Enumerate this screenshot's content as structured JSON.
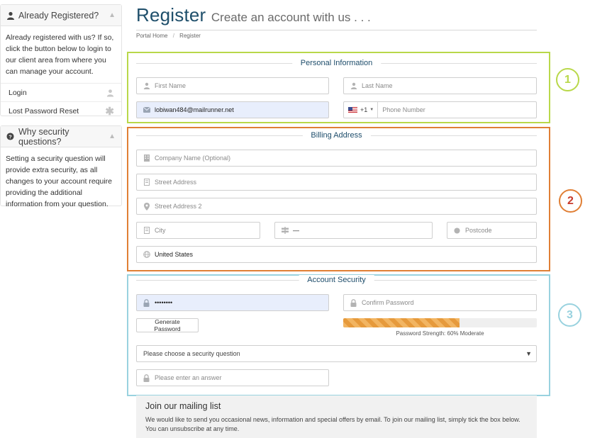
{
  "sidebar": {
    "registered_panel": {
      "title": "Already Registered?",
      "body": "Already registered with us? If so, click the button below to login to our client area from where you can manage your account.",
      "links": [
        {
          "label": "Login",
          "icon": "user-icon"
        },
        {
          "label": "Lost Password Reset",
          "icon": "asterisk-icon"
        }
      ]
    },
    "security_panel": {
      "title": "Why security questions?",
      "body": "Setting a security question will provide extra security, as all changes to your account require providing the additional information from your question."
    }
  },
  "header": {
    "title": "Register",
    "subtitle": "Create an account with us . . .",
    "breadcrumb": [
      "Portal Home",
      "Register"
    ]
  },
  "personal": {
    "legend": "Personal Information",
    "first_name_placeholder": "First Name",
    "last_name_placeholder": "Last Name",
    "email_value": "lobiwan484@mailrunner.net",
    "phone_code": "+1",
    "phone_placeholder": "Phone Number"
  },
  "billing": {
    "legend": "Billing Address",
    "company_placeholder": "Company Name (Optional)",
    "street_placeholder": "Street Address",
    "street2_placeholder": "Street Address 2",
    "city_placeholder": "City",
    "state_value": "—",
    "postcode_placeholder": "Postcode",
    "country_value": "United States"
  },
  "security": {
    "legend": "Account Security",
    "password_value": "••••••••",
    "confirm_placeholder": "Confirm Password",
    "generate_label": "Generate Password",
    "strength_percent": 60,
    "strength_text": "Password Strength: 60% Moderate",
    "question_value": "Please choose a security question",
    "answer_placeholder": "Please enter an answer"
  },
  "annotations": {
    "circle_1": "1",
    "circle_2": "2",
    "circle_3": "3"
  },
  "mailing": {
    "title": "Join our mailing list",
    "description": "We would like to send you occasional news, information and special offers by email. To join our mailing list, simply tick the box below. You can unsubscribe at any time."
  },
  "colors": {
    "section_personal": "#b9d84a",
    "section_billing": "#e07f35",
    "section_security": "#99d2df",
    "title_blue": "#1f4f6b",
    "filled_field_bg": "#e8eefc"
  }
}
